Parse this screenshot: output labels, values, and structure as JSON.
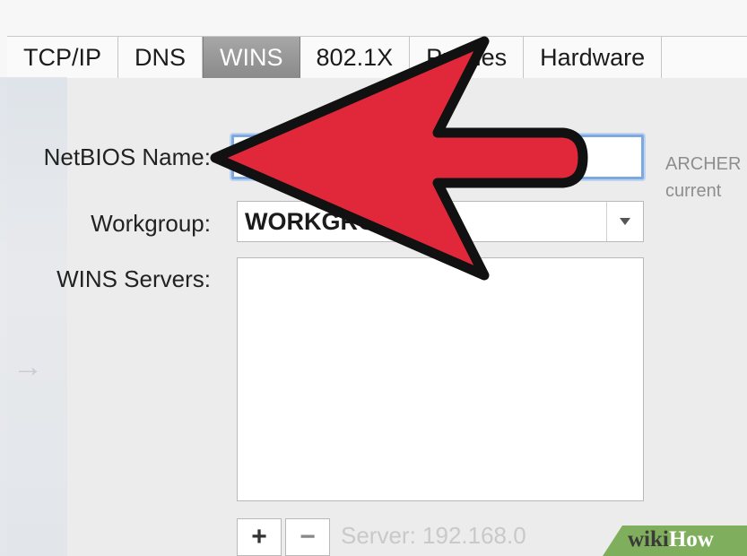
{
  "tabs": [
    {
      "label": "TCP/IP",
      "active": false
    },
    {
      "label": "DNS",
      "active": false
    },
    {
      "label": "WINS",
      "active": true
    },
    {
      "label": "802.1X",
      "active": false
    },
    {
      "label": "Proxies",
      "active": false
    },
    {
      "label": "Hardware",
      "active": false
    }
  ],
  "form": {
    "netbios_label": "NetBIOS Name:",
    "netbios_value": "",
    "hint_line1": "ARCHER",
    "hint_line2": "current",
    "workgroup_label": "Workgroup:",
    "workgroup_value": "WORKGROUP",
    "wins_label": "WINS Servers:",
    "add_label": "+",
    "remove_label": "−",
    "server_text": "Server:  192.168.0"
  },
  "watermark": {
    "part1": "wiki",
    "part2": "How"
  },
  "colors": {
    "arrow_fill": "#e0283a",
    "arrow_outline": "#111111",
    "focus_ring": "#7ea9e0",
    "active_tab": "#959595",
    "watermark_bg": "#7fae5c"
  },
  "icons": {
    "dropdown": "chevron-down-icon",
    "annotation": "red-arrow"
  }
}
